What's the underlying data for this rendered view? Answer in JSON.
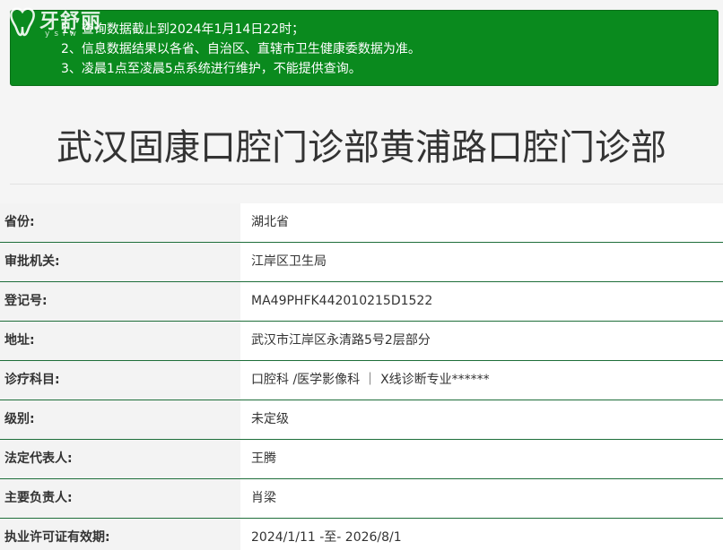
{
  "logo": {
    "text": "牙舒丽",
    "subtext": "yslw"
  },
  "notice": {
    "lines": [
      "1、查询数据截止到2024年1月14日22时；",
      "2、信息数据结果以各省、自治区、直辖市卫生健康委数据为准。",
      "3、凌晨1点至凌晨5点系统进行维护，不能提供查询。"
    ]
  },
  "title": "武汉固康口腔门诊部黄浦路口腔门诊部",
  "details": [
    {
      "label": "省份:",
      "value": "湖北省"
    },
    {
      "label": "审批机关:",
      "value": "江岸区卫生局"
    },
    {
      "label": "登记号:",
      "value": "MA49PHFK442010215D1522"
    },
    {
      "label": "地址:",
      "value": "武汉市江岸区永清路5号2层部分"
    },
    {
      "label": "诊疗科目:",
      "value": "口腔科 /医学影像科 ｜ X线诊断专业******"
    },
    {
      "label": "级别:",
      "value": "未定级"
    },
    {
      "label": "法定代表人:",
      "value": "王腾"
    },
    {
      "label": "主要负责人:",
      "value": "肖梁"
    },
    {
      "label": "执业许可证有效期:",
      "value": "2024/1/11 -至- 2026/8/1"
    }
  ],
  "colors": {
    "notice_bg": "#0a8a1e",
    "row_border": "#1e6e3a",
    "label_bg": "#f3f3f3",
    "text": "#333333"
  }
}
